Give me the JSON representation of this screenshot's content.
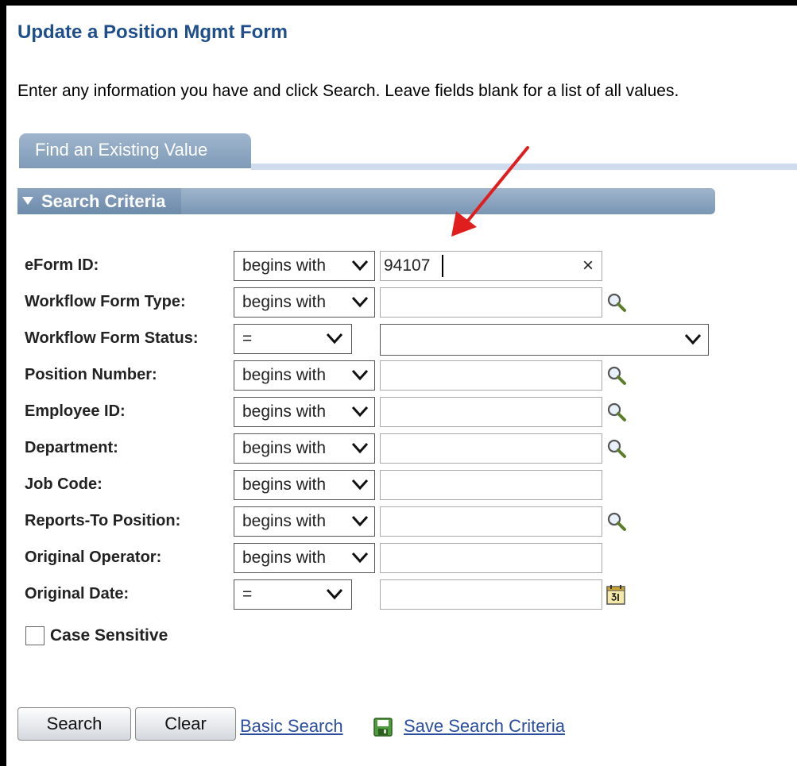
{
  "page": {
    "title": "Update a Position Mgmt Form",
    "instructions": "Enter any information you have and click Search. Leave fields blank for a list of all values."
  },
  "tab": {
    "label": "Find an Existing Value"
  },
  "section": {
    "label": "Search Criteria"
  },
  "fields": {
    "eform_id": {
      "label": "eForm ID:",
      "operator": "begins with",
      "value": "94107"
    },
    "workflow_form_type": {
      "label": "Workflow Form Type:",
      "operator": "begins with",
      "value": ""
    },
    "workflow_form_status": {
      "label": "Workflow Form Status:",
      "operator": "=",
      "value": ""
    },
    "position_number": {
      "label": "Position Number:",
      "operator": "begins with",
      "value": ""
    },
    "employee_id": {
      "label": "Employee ID:",
      "operator": "begins with",
      "value": ""
    },
    "department": {
      "label": "Department:",
      "operator": "begins with",
      "value": ""
    },
    "job_code": {
      "label": "Job Code:",
      "operator": "begins with",
      "value": ""
    },
    "reports_to_position": {
      "label": "Reports-To Position:",
      "operator": "begins with",
      "value": ""
    },
    "original_operator": {
      "label": "Original Operator:",
      "operator": "begins with",
      "value": ""
    },
    "original_date": {
      "label": "Original Date:",
      "operator": "=",
      "value": ""
    }
  },
  "case_sensitive": {
    "label": "Case Sensitive",
    "checked": false
  },
  "buttons": {
    "search": "Search",
    "clear": "Clear"
  },
  "links": {
    "basic_search": "Basic Search",
    "save_search": "Save Search Criteria"
  },
  "icons": {
    "lookup": "magnifier-icon",
    "calendar": "calendar-icon",
    "save": "save-disk-icon",
    "clear": "clear-x-icon"
  },
  "colors": {
    "title": "#1f4e8c",
    "tab": "#8fa8c4",
    "link": "#2a4d9e",
    "annotation_arrow": "#e01e1e"
  }
}
